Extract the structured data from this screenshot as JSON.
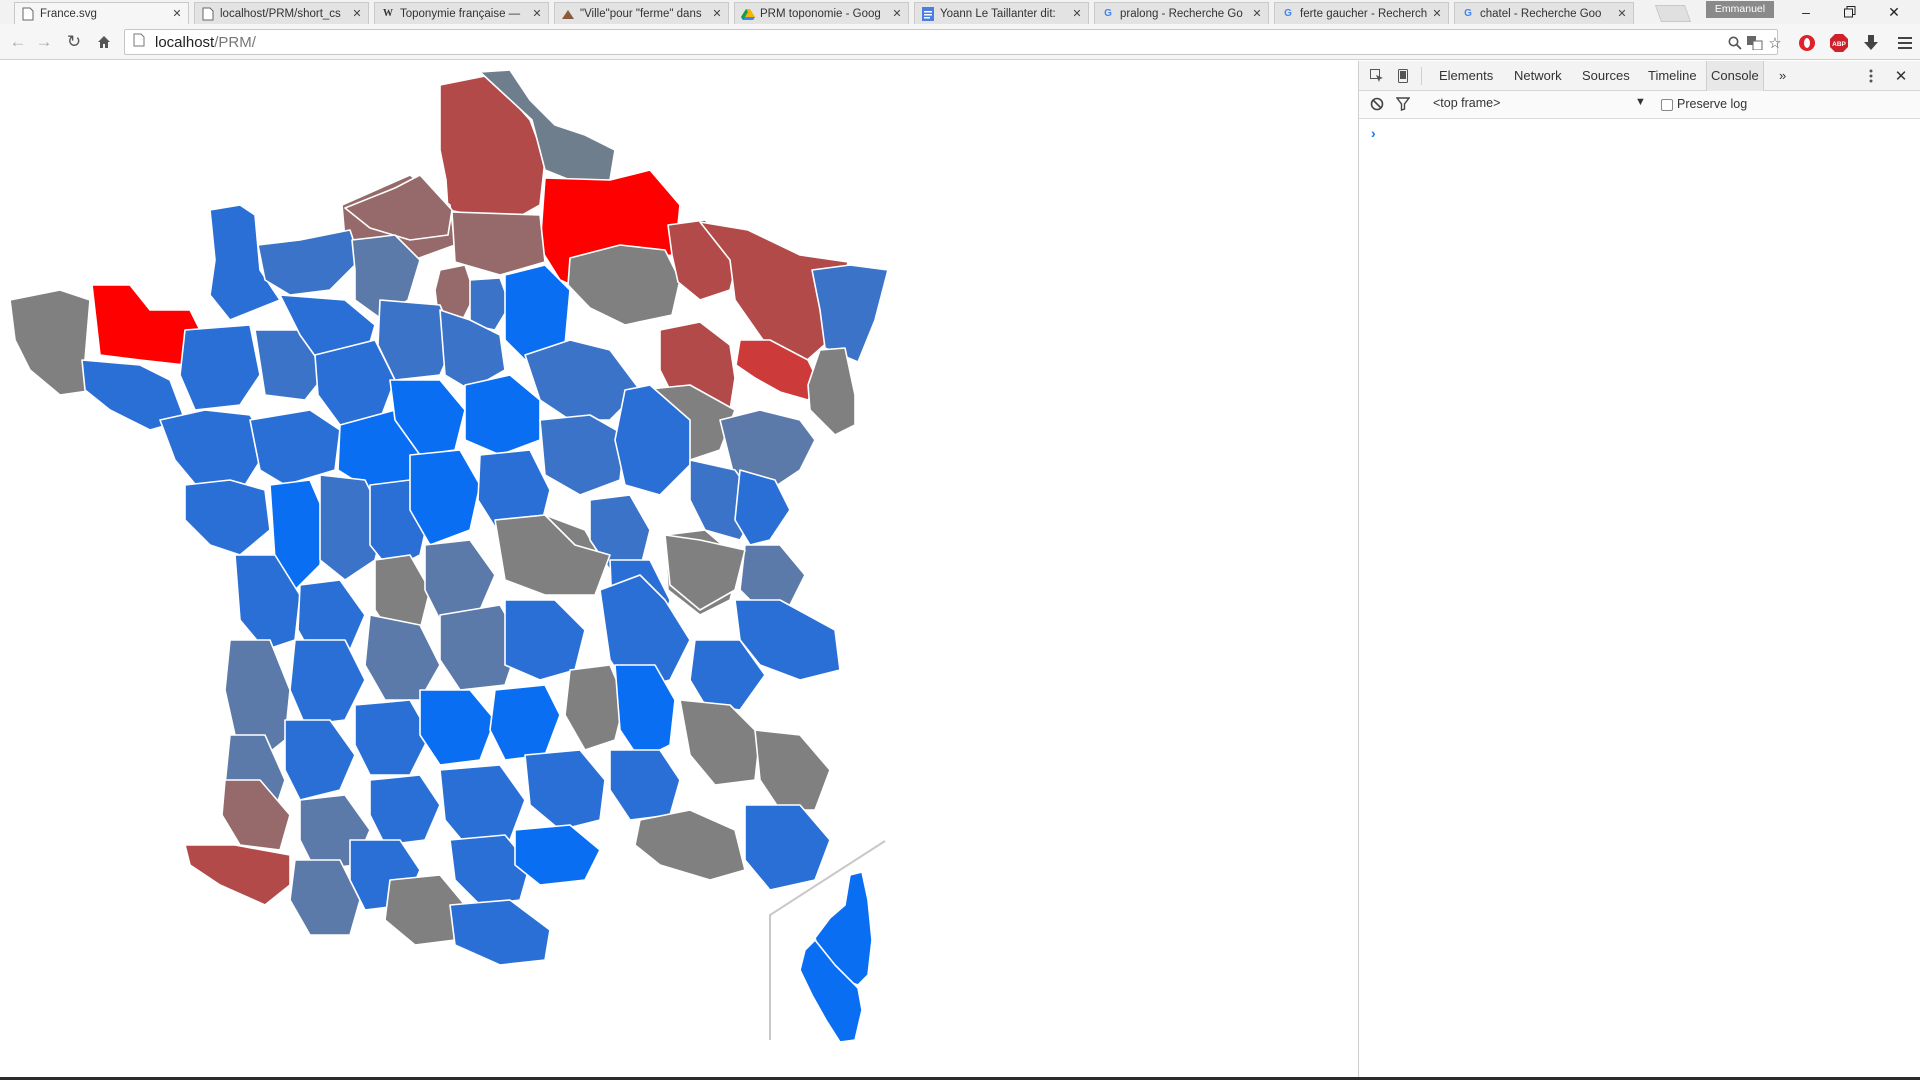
{
  "tabs": [
    {
      "title": "France.svg",
      "icon": "page-icon",
      "active": true
    },
    {
      "title": "localhost/PRM/short_cs",
      "icon": "page-icon",
      "active": false
    },
    {
      "title": "Toponymie française —",
      "icon": "wikipedia-icon",
      "icon_glyph": "W",
      "active": false
    },
    {
      "title": "\"Ville\"pour \"ferme\" dans",
      "icon": "forum-icon",
      "active": false
    },
    {
      "title": "PRM toponomie - Goog",
      "icon": "drive-icon",
      "active": false
    },
    {
      "title": "Yoann Le Taillanter dit:",
      "icon": "docs-icon",
      "active": false
    },
    {
      "title": "pralong - Recherche Go",
      "icon": "google-icon",
      "icon_glyph": "G",
      "active": false
    },
    {
      "title": "ferte gaucher - Recherch",
      "icon": "google-icon",
      "icon_glyph": "G",
      "active": false
    },
    {
      "title": "chatel - Recherche Goo",
      "icon": "google-icon",
      "icon_glyph": "G",
      "active": false
    }
  ],
  "profile_name": "Emmanuel",
  "address_bar": {
    "host": "localhost",
    "path": "/PRM/"
  },
  "devtools": {
    "tabs": [
      "Elements",
      "Network",
      "Sources",
      "Timeline",
      "Console"
    ],
    "active_tab": "Console",
    "overflow_label": "»",
    "frame_selector": "<top frame>",
    "preserve_log_label": "Preserve log",
    "preserve_log_checked": false,
    "prompt": "›"
  },
  "colors": {
    "strong_red": "#ff0000",
    "dark_red": "#cc3a3a",
    "brick": "#b24a4a",
    "mauve": "#966a6a",
    "slate_grey": "#6f7e8c",
    "grey": "#808080",
    "steel_blue": "#5b7aa9",
    "mid_blue": "#3b73c8",
    "blue": "#2a6fd6",
    "bright_blue": "#0a6ef2"
  }
}
